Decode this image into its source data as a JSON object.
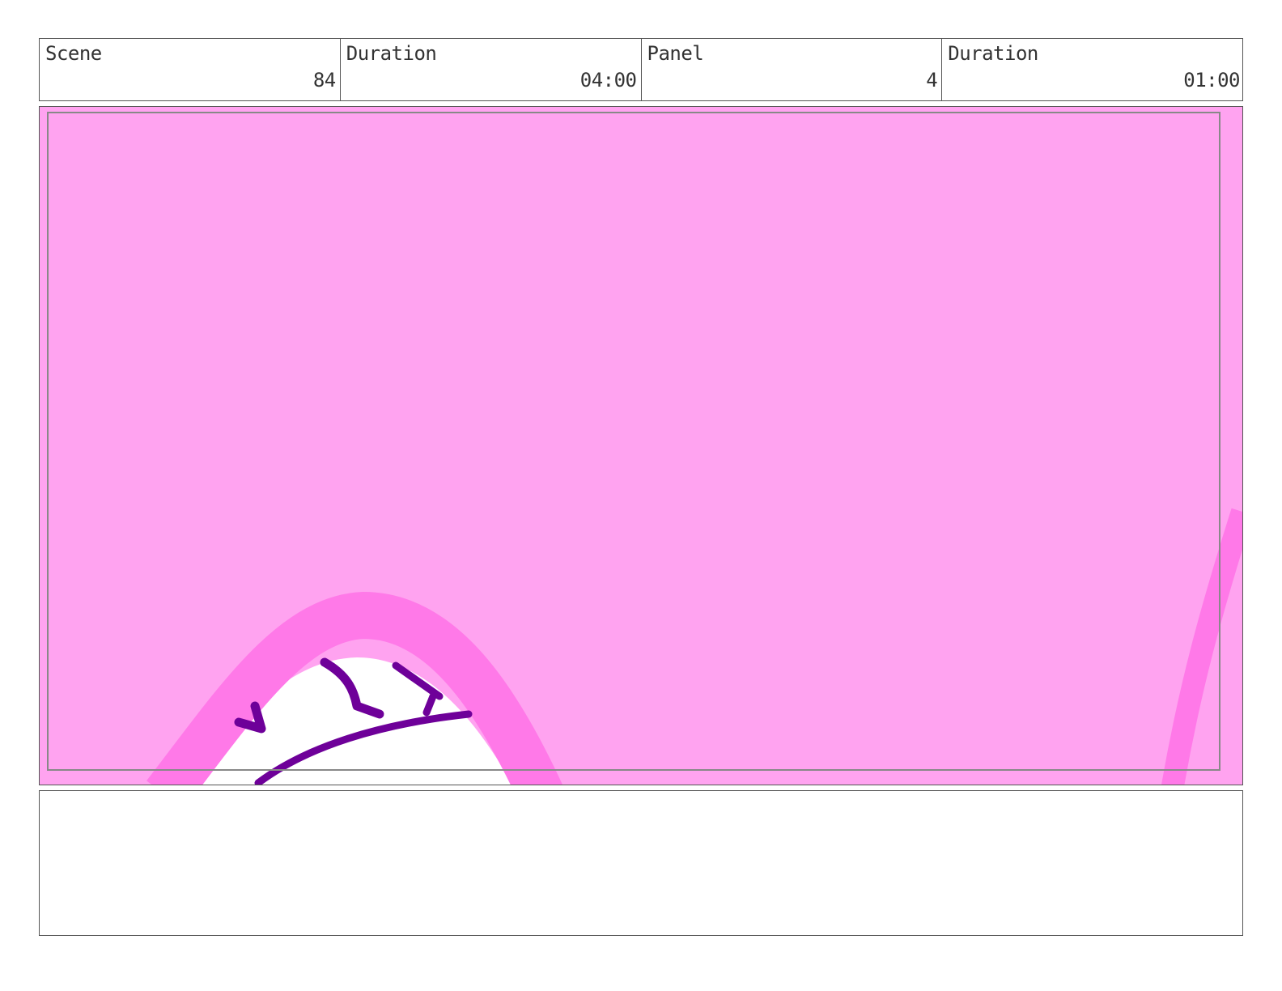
{
  "header": {
    "scene_label": "Scene",
    "scene_value": "84",
    "duration_label": "Duration",
    "duration_value": "04:00",
    "panel_label": "Panel",
    "panel_value": "4",
    "panel_duration_label": "Duration",
    "panel_duration_value": "01:00"
  },
  "artwork": {
    "fill_color": "#ffa3f0",
    "stroke_color": "#ff79e8",
    "line_color": "#6e0099",
    "safe_frame_color": "#888888"
  },
  "notes": {
    "text": ""
  }
}
